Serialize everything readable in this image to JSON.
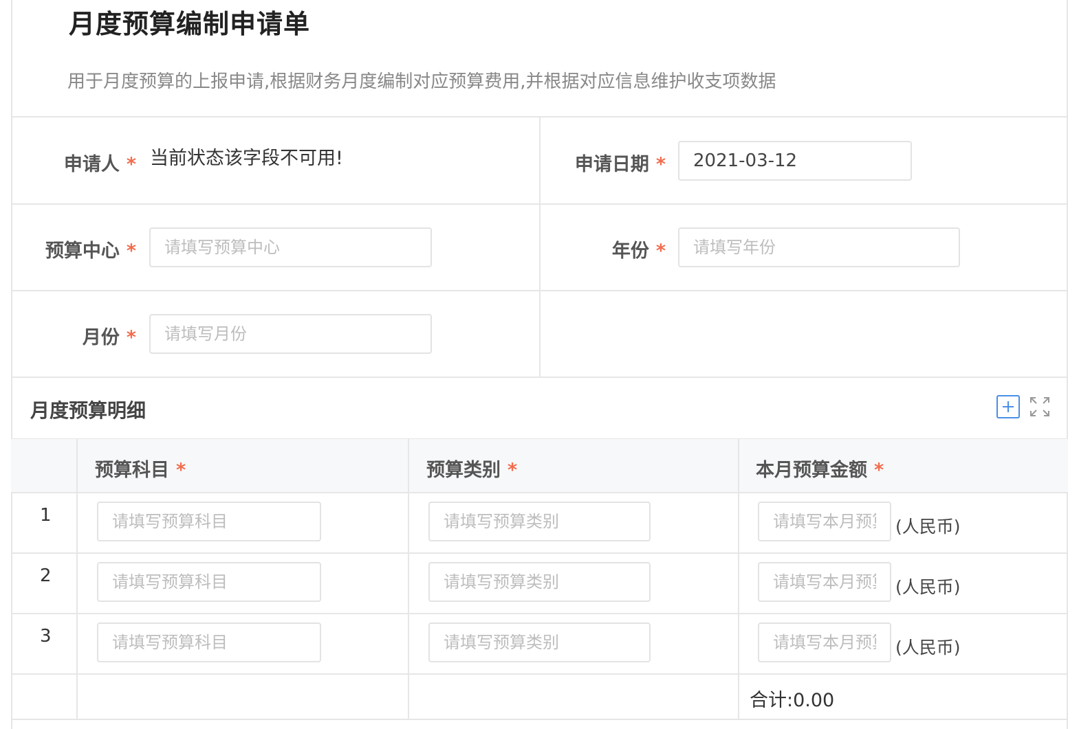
{
  "header": {
    "title": "月度预算编制申请单",
    "description": "用于月度预算的上报申请,根据财务月度编制对应预算费用,并根据对应信息维护收支项数据"
  },
  "form": {
    "required_mark": "*",
    "applicant": {
      "label": "申请人",
      "value": "当前状态该字段不可用!"
    },
    "apply_date": {
      "label": "申请日期",
      "value": "2021-03-12"
    },
    "budget_center": {
      "label": "预算中心",
      "placeholder": "请填写预算中心"
    },
    "year": {
      "label": "年份",
      "placeholder": "请填写年份"
    },
    "month": {
      "label": "月份",
      "placeholder": "请填写月份"
    }
  },
  "detail": {
    "section_title": "月度预算明细",
    "add_icon": "plus-square-icon",
    "expand_icon": "fullscreen-expand-icon",
    "columns": {
      "subject": "预算科目",
      "category": "预算类别",
      "amount": "本月预算金额"
    },
    "rows": [
      {
        "index": "1",
        "subject_placeholder": "请填写预算科目",
        "category_placeholder": "请填写预算类别",
        "amount_placeholder": "请填写本月预算金额",
        "unit": "(人民币)"
      },
      {
        "index": "2",
        "subject_placeholder": "请填写预算科目",
        "category_placeholder": "请填写预算类别",
        "amount_placeholder": "请填写本月预算金额",
        "unit": "(人民币)"
      },
      {
        "index": "3",
        "subject_placeholder": "请填写预算科目",
        "category_placeholder": "请填写预算类别",
        "amount_placeholder": "请填写本月预算金额",
        "unit": "(人民币)"
      }
    ],
    "total": "合计:0.00"
  },
  "colors": {
    "required": "#f26b4c",
    "accent": "#4a8fe7",
    "border": "#e6e6e6"
  }
}
